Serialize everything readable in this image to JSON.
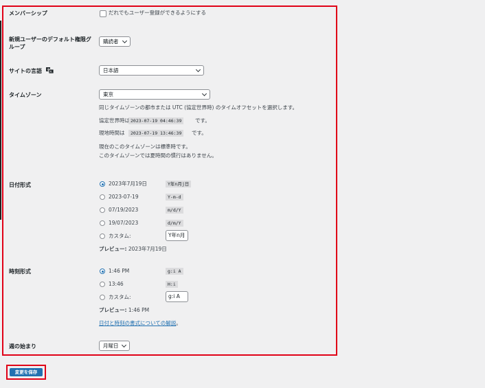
{
  "membership": {
    "label": "メンバーシップ",
    "checkbox_label": "だれでもユーザー登録ができるようにする"
  },
  "default_role": {
    "label": "新規ユーザーのデフォルト権限グループ",
    "value": "購読者"
  },
  "site_language": {
    "label": "サイトの言語",
    "value": "日本語"
  },
  "timezone": {
    "label": "タイムゾーン",
    "value": "東京",
    "description": "同じタイムゾーンの都市または UTC (協定世界時) のタイムオフセットを選択します。",
    "utc_prefix": "協定世界時は",
    "utc_value": "2023-07-19 04:46:39",
    "utc_suffix": "です。",
    "local_prefix": "現地時間は",
    "local_value": "2023-07-19 13:46:39",
    "local_suffix": "です。",
    "note1": "現在のこのタイムゾーンは標準時です。",
    "note2": "このタイムゾーンでは夏時間の慣行はありません。"
  },
  "date_format": {
    "label": "日付形式",
    "options": [
      {
        "display": "2023年7月19日",
        "code": "Y年n月j日",
        "checked": true
      },
      {
        "display": "2023-07-19",
        "code": "Y-m-d",
        "checked": false
      },
      {
        "display": "07/19/2023",
        "code": "m/d/Y",
        "checked": false
      },
      {
        "display": "19/07/2023",
        "code": "d/m/Y",
        "checked": false
      }
    ],
    "custom_label": "カスタム:",
    "custom_value": "Y年n月",
    "preview_label": "プレビュー:",
    "preview_value": "2023年7月19日"
  },
  "time_format": {
    "label": "時刻形式",
    "options": [
      {
        "display": "1:46 PM",
        "code": "g:i A",
        "checked": true
      },
      {
        "display": "13:46",
        "code": "H:i",
        "checked": false
      }
    ],
    "custom_label": "カスタム:",
    "custom_value": "g:i A",
    "preview_label": "プレビュー:",
    "preview_value": "1:46 PM",
    "help_link": "日付と時刻の書式についての解説",
    "help_link_suffix": "。"
  },
  "week_start": {
    "label": "週の始まり",
    "value": "月曜日"
  },
  "save_button": "変更を保存",
  "colors": {
    "highlight": "#e00016",
    "accent": "#2271b1"
  }
}
